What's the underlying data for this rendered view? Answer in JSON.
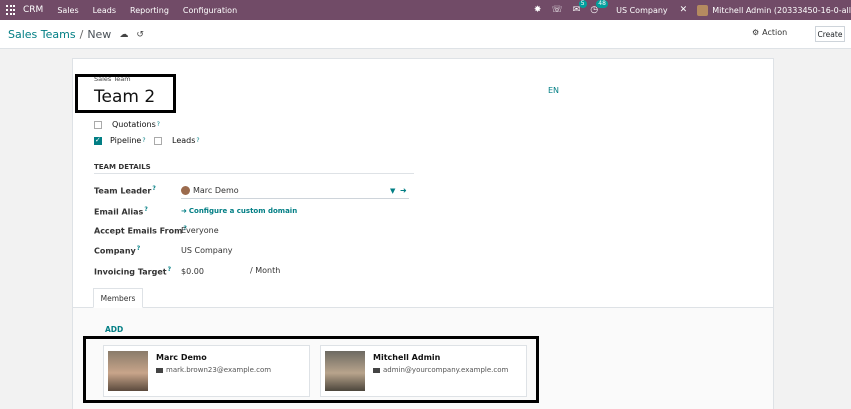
{
  "navbar": {
    "app_name": "CRM",
    "menu": [
      "Sales",
      "Leads",
      "Reporting",
      "Configuration"
    ],
    "messages_count": "5",
    "activities_count": "48",
    "company": "US Company",
    "user": "Mitchell Admin (20333450-16-0-all"
  },
  "breadcrumb": {
    "parent": "Sales Teams",
    "separator": "/",
    "current": "New"
  },
  "toolbar": {
    "action_label": "Action",
    "create_label": "Create"
  },
  "form": {
    "name_label": "Sales Team",
    "name_value": "Team 2",
    "language": "EN",
    "options": [
      {
        "label": "Quotations",
        "checked": false
      },
      {
        "label": "Pipeline",
        "checked": true
      },
      {
        "label": "Leads",
        "checked": false
      }
    ],
    "section_title": "TEAM DETAILS",
    "fields": {
      "team_leader": {
        "label": "Team Leader",
        "value": "Marc Demo"
      },
      "email_alias": {
        "label": "Email Alias",
        "value": "Configure a custom domain"
      },
      "accept_emails": {
        "label": "Accept Emails From",
        "value": "Everyone"
      },
      "company": {
        "label": "Company",
        "value": "US Company"
      },
      "invoicing_target": {
        "label": "Invoicing Target",
        "value": "$0.00",
        "unit": "/ Month"
      }
    },
    "help_mark": "?",
    "tabs": [
      "Members"
    ],
    "add_label": "ADD",
    "members": [
      {
        "name": "Marc Demo",
        "email": "mark.brown23@example.com"
      },
      {
        "name": "Mitchell Admin",
        "email": "admin@yourcompany.example.com"
      }
    ]
  },
  "colors": {
    "navbar": "#714b67",
    "accent": "#017e84"
  }
}
